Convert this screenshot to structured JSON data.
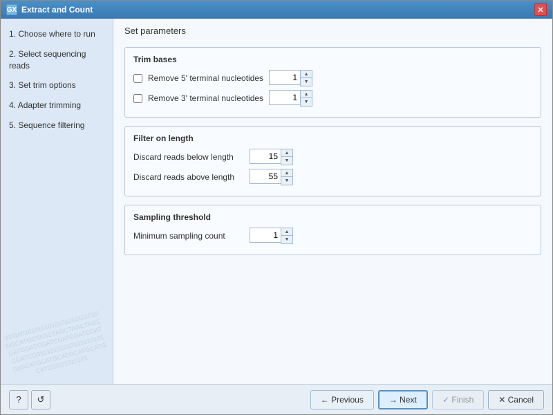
{
  "window": {
    "title": "Extract and Count",
    "icon_label": "GX",
    "close_label": "✕"
  },
  "sidebar": {
    "items": [
      {
        "number": "1.",
        "label": "Choose where to run"
      },
      {
        "number": "2.",
        "label": "Select sequencing reads"
      },
      {
        "number": "3.",
        "label": "Set trim options"
      },
      {
        "number": "4.",
        "label": "Adapter trimming"
      },
      {
        "number": "5.",
        "label": "Sequence filtering"
      }
    ],
    "watermark": "0101001010101010101010101010NGCATGCTAGCTAGCTAGCTAGCGATCGATCGATCGATCGATCGATCGATCG0101010101010101010101GCATGCATGCATGCATGCATGCAT010101010101"
  },
  "main": {
    "header": "Set parameters",
    "sections": [
      {
        "id": "trim-bases",
        "title": "Trim bases",
        "rows": [
          {
            "type": "checkbox-spinner",
            "label": "Remove 5' terminal nucleotides",
            "checked": false,
            "value": "1"
          },
          {
            "type": "checkbox-spinner",
            "label": "Remove 3' terminal nucleotides",
            "checked": false,
            "value": "1"
          }
        ]
      },
      {
        "id": "filter-length",
        "title": "Filter on length",
        "rows": [
          {
            "type": "label-spinner",
            "label": "Discard reads below length",
            "value": "15"
          },
          {
            "type": "label-spinner",
            "label": "Discard reads above length",
            "value": "55"
          }
        ]
      },
      {
        "id": "sampling-threshold",
        "title": "Sampling threshold",
        "rows": [
          {
            "type": "label-spinner",
            "label": "Minimum sampling count",
            "value": "1"
          }
        ]
      }
    ]
  },
  "footer": {
    "help_label": "?",
    "reset_label": "↺",
    "previous_label": "← Previous",
    "next_label": "→ Next",
    "finish_label": "✓ Finish",
    "cancel_label": "✕ Cancel"
  }
}
